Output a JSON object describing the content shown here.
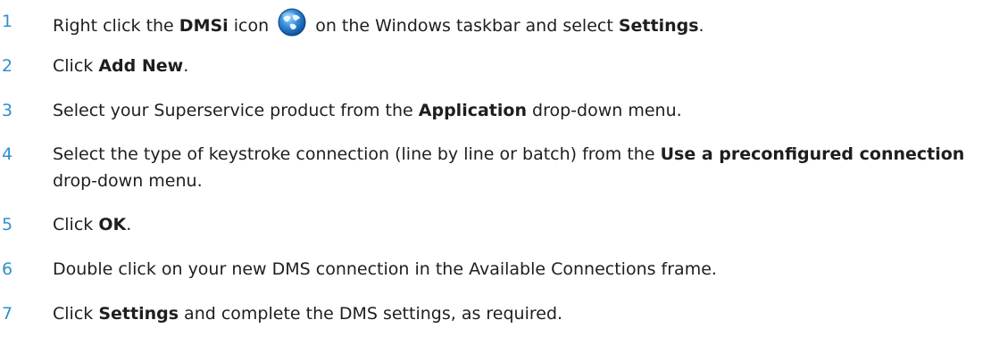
{
  "steps": [
    {
      "number": "1",
      "parts": [
        {
          "text": "Right click the ",
          "bold": false
        },
        {
          "text": "DMSi",
          "bold": true
        },
        {
          "text": " icon ",
          "bold": false
        },
        {
          "icon": "dmsi-globe-icon"
        },
        {
          "text": " on the Windows taskbar and select ",
          "bold": false
        },
        {
          "text": "Settings",
          "bold": true
        },
        {
          "text": ".",
          "bold": false
        }
      ]
    },
    {
      "number": "2",
      "parts": [
        {
          "text": "Click ",
          "bold": false
        },
        {
          "text": "Add New",
          "bold": true
        },
        {
          "text": ".",
          "bold": false
        }
      ]
    },
    {
      "number": "3",
      "parts": [
        {
          "text": "Select your Superservice product from the ",
          "bold": false
        },
        {
          "text": "Application",
          "bold": true
        },
        {
          "text": " drop-down menu.",
          "bold": false
        }
      ]
    },
    {
      "number": "4",
      "parts": [
        {
          "text": "Select the type of keystroke connection (line by line or batch) from the ",
          "bold": false
        },
        {
          "text": "Use a preconfigured connection",
          "bold": true
        },
        {
          "text": " drop-down menu.",
          "bold": false
        }
      ]
    },
    {
      "number": "5",
      "parts": [
        {
          "text": "Click ",
          "bold": false
        },
        {
          "text": "OK",
          "bold": true
        },
        {
          "text": ".",
          "bold": false
        }
      ]
    },
    {
      "number": "6",
      "parts": [
        {
          "text": "Double click on your new DMS connection in the Available Connections frame.",
          "bold": false
        }
      ]
    },
    {
      "number": "7",
      "parts": [
        {
          "text": "Click ",
          "bold": false
        },
        {
          "text": "Settings",
          "bold": true
        },
        {
          "text": " and complete the DMS settings, as required.",
          "bold": false
        }
      ]
    }
  ]
}
